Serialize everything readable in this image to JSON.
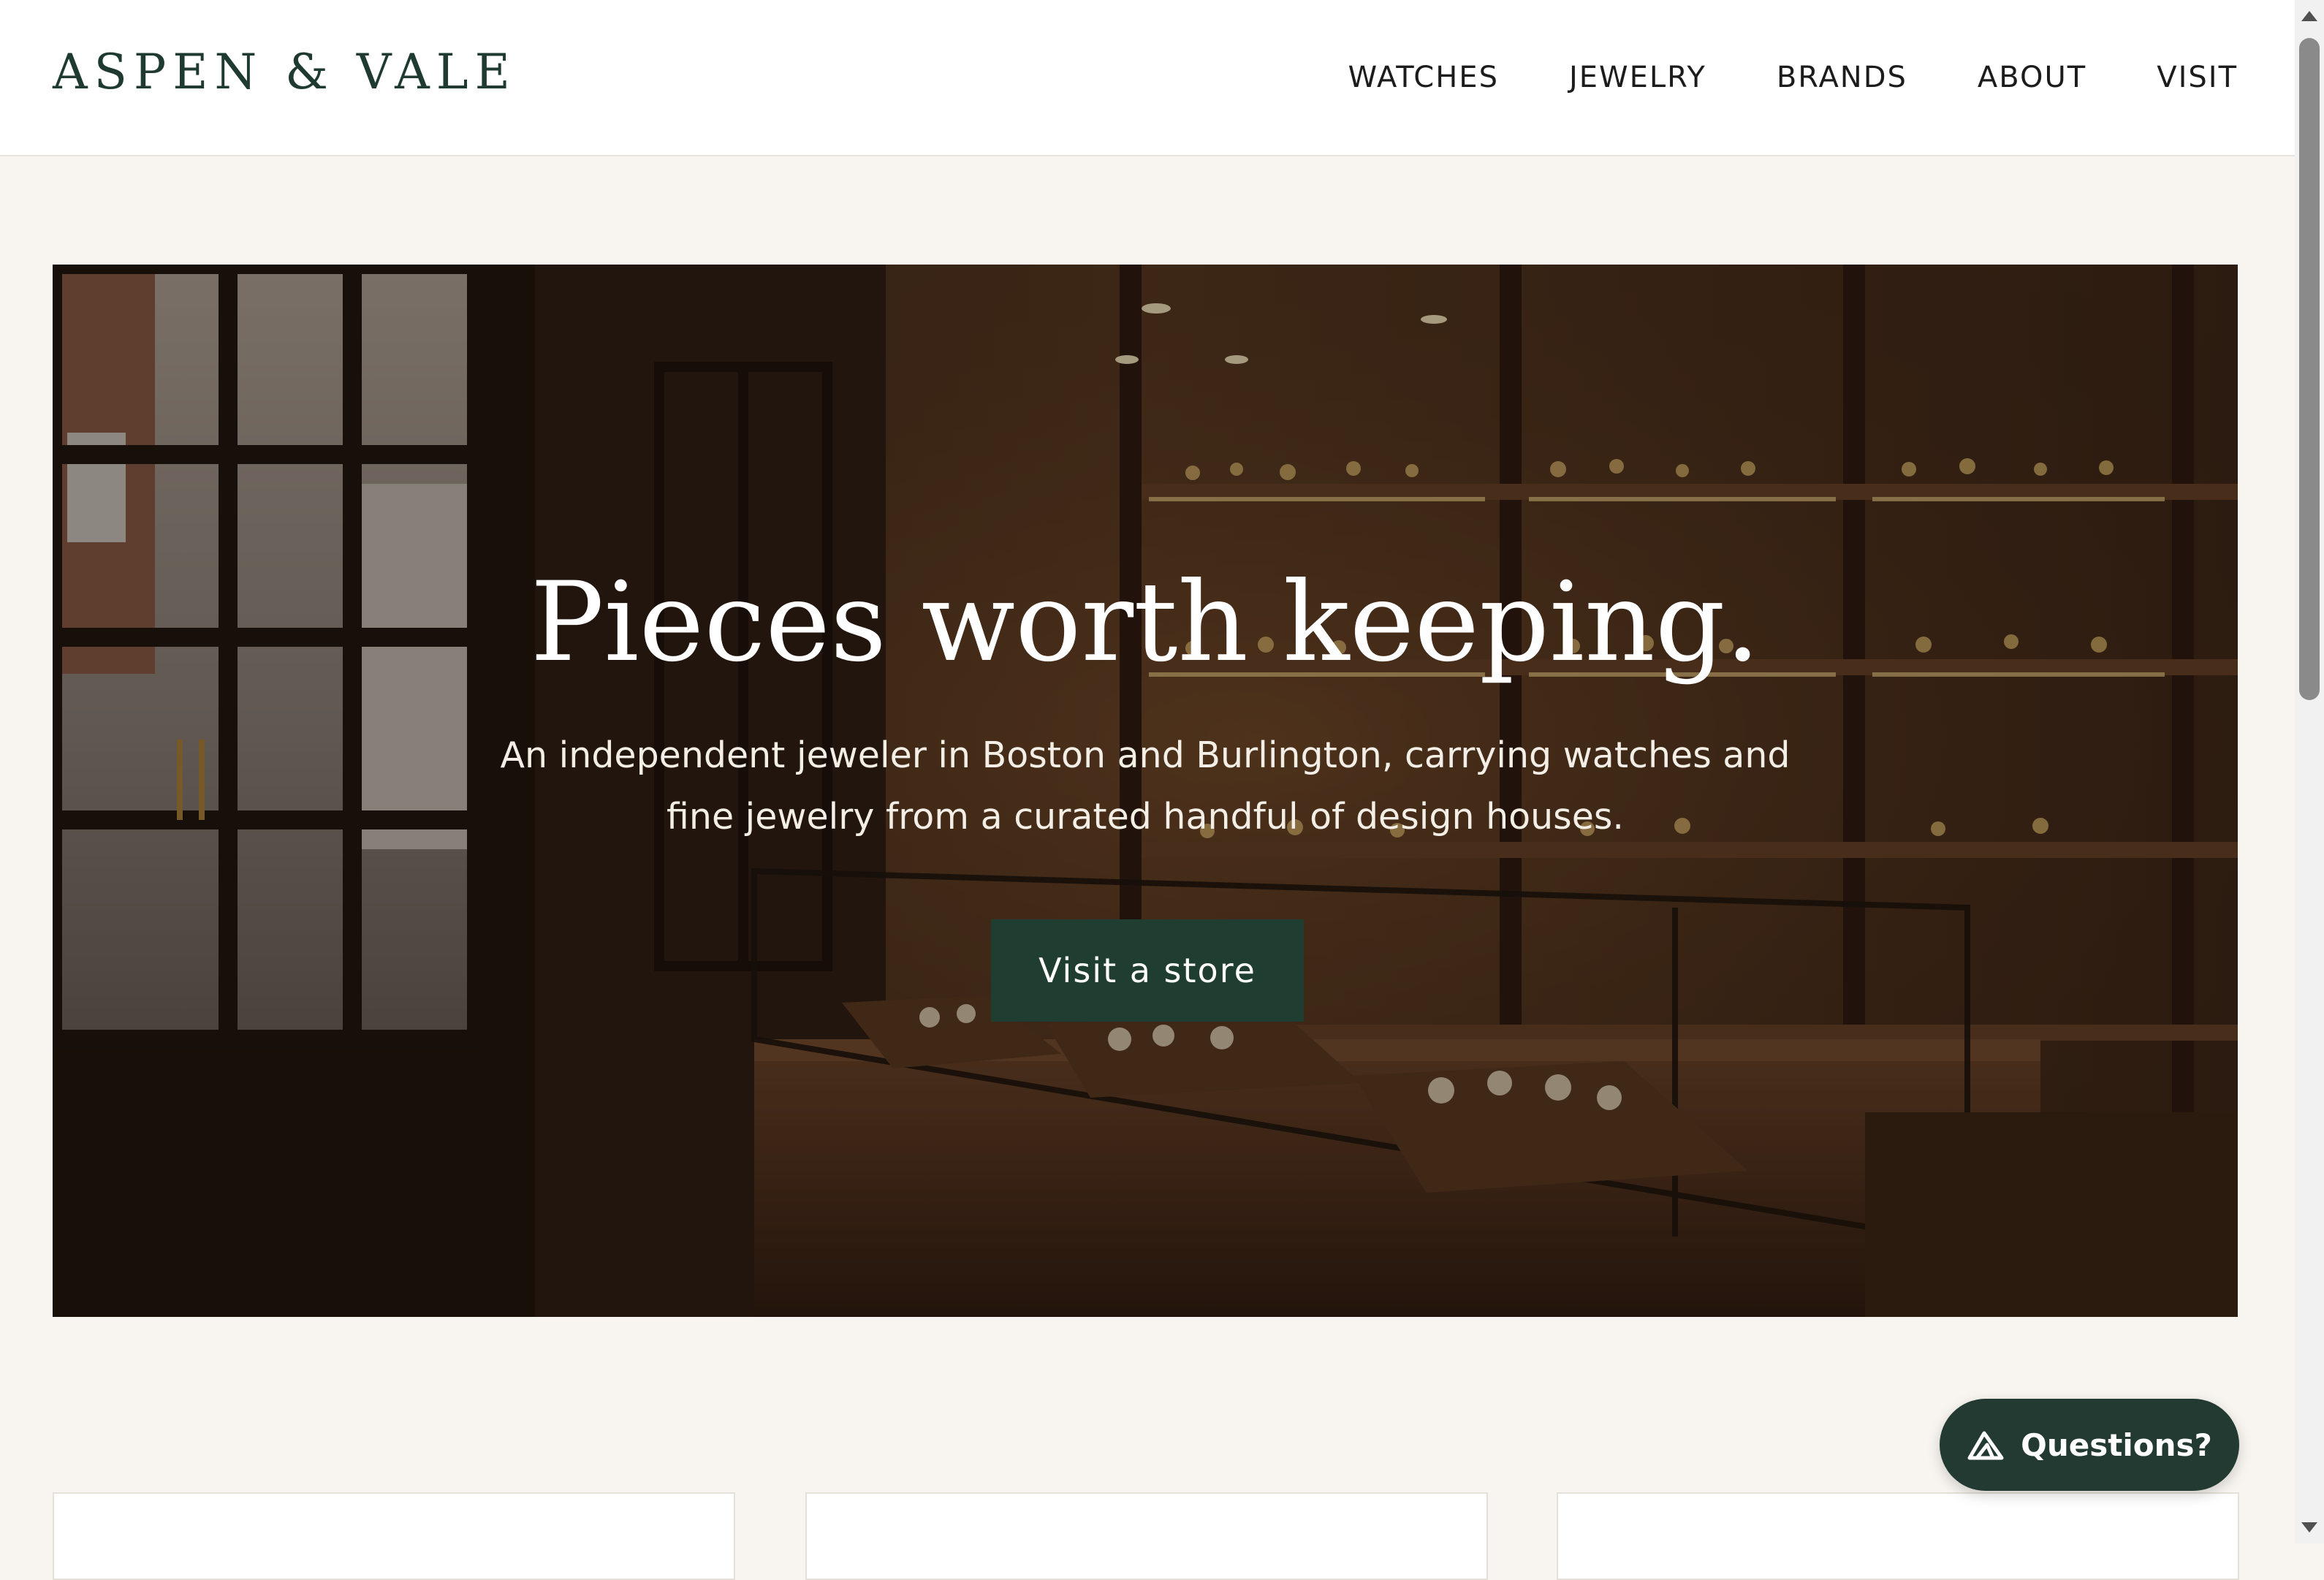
{
  "brand": {
    "logo_text": "ASPEN & VALE"
  },
  "nav": {
    "items": [
      {
        "label": "WATCHES"
      },
      {
        "label": "JEWELRY"
      },
      {
        "label": "BRANDS"
      },
      {
        "label": "ABOUT"
      },
      {
        "label": "VISIT"
      }
    ]
  },
  "hero": {
    "title": "Pieces worth keeping.",
    "subtitle": "An independent jeweler in Boston and Burlington, carrying watches and fine jewelry from a curated handful of design houses.",
    "cta_label": "Visit a store",
    "image_description_icon": "jewelry-store-interior-image"
  },
  "chat": {
    "label": "Questions?",
    "icon": "mountain-logo-icon"
  },
  "colors": {
    "accent": "#1f3d30",
    "logo": "#1f3a31",
    "page_background": "#f8f5f0",
    "chat_background": "#233a32"
  }
}
